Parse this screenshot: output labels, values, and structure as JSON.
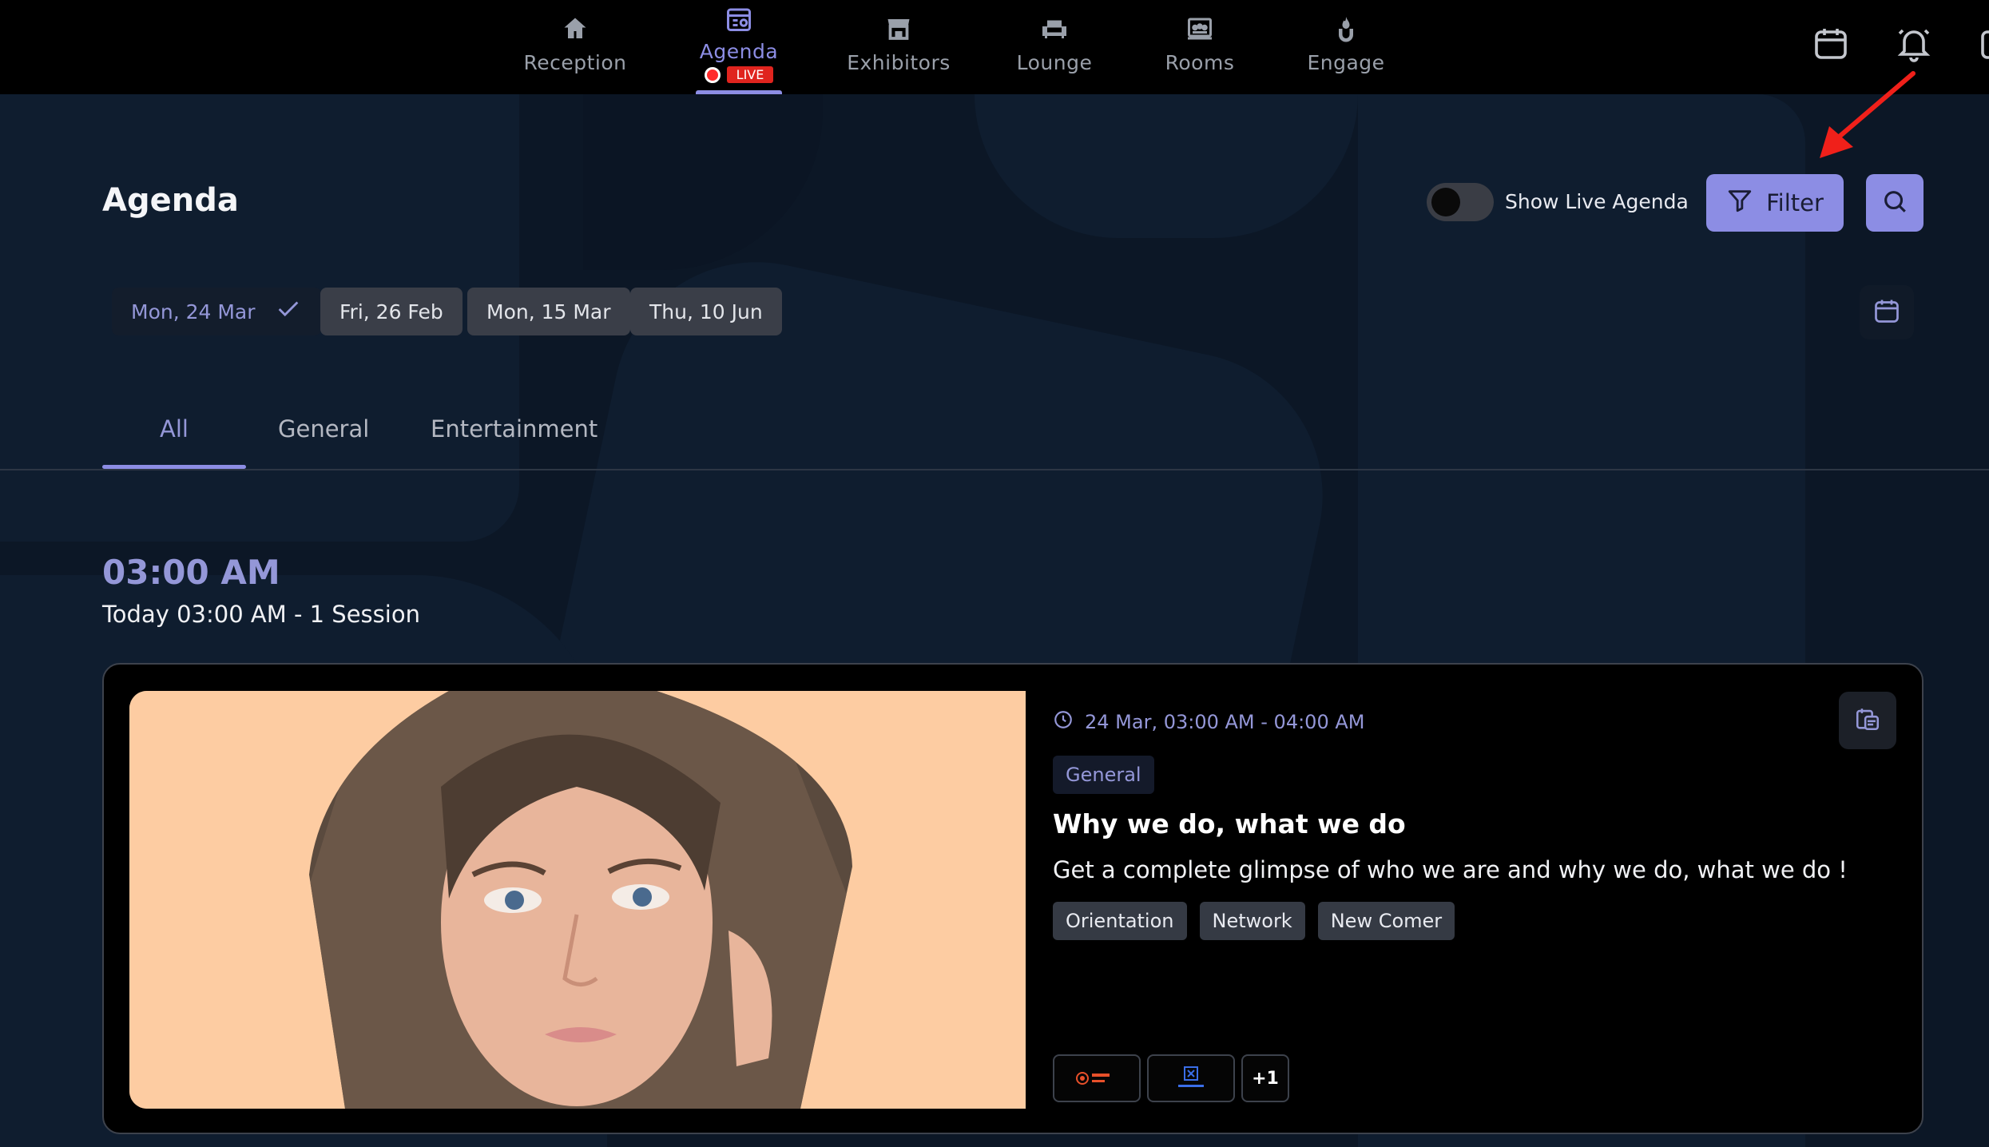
{
  "nav": {
    "items": [
      {
        "label": "Reception",
        "icon": "home-icon"
      },
      {
        "label": "Agenda",
        "icon": "agenda-icon",
        "active": true,
        "badge": "LIVE"
      },
      {
        "label": "Exhibitors",
        "icon": "store-icon"
      },
      {
        "label": "Lounge",
        "icon": "sofa-icon"
      },
      {
        "label": "Rooms",
        "icon": "rooms-icon"
      },
      {
        "label": "Engage",
        "icon": "engage-icon"
      }
    ],
    "right_icons": [
      "calendar-icon",
      "bell-icon"
    ]
  },
  "header": {
    "title": "Agenda",
    "live_toggle_label": "Show Live Agenda",
    "live_toggle_on": false,
    "filter_label": "Filter"
  },
  "dates": [
    {
      "label": "Mon, 24 Mar",
      "selected": true
    },
    {
      "label": "Fri, 26 Feb",
      "selected": false
    },
    {
      "label": "Mon, 15 Mar",
      "selected": false
    },
    {
      "label": "Thu, 10 Jun",
      "selected": false
    }
  ],
  "tabs": [
    {
      "label": "All",
      "active": true
    },
    {
      "label": "General",
      "active": false
    },
    {
      "label": "Entertainment",
      "active": false
    }
  ],
  "group": {
    "time": "03:00 AM",
    "summary": "Today 03:00 AM - 1  Session"
  },
  "session": {
    "time_range": "24 Mar, 03:00 AM - 04:00 AM",
    "track": "General",
    "title": "Why we do, what we do",
    "description": "Get a complete glimpse of who we are and why we do, what we do !",
    "tags": [
      "Orientation",
      "Network",
      "New Comer"
    ],
    "sponsor_more": "+1"
  },
  "colors": {
    "accent": "#8c8de4",
    "live": "#e0241e",
    "background": "#0c1726",
    "nav_bg": "#000000"
  }
}
